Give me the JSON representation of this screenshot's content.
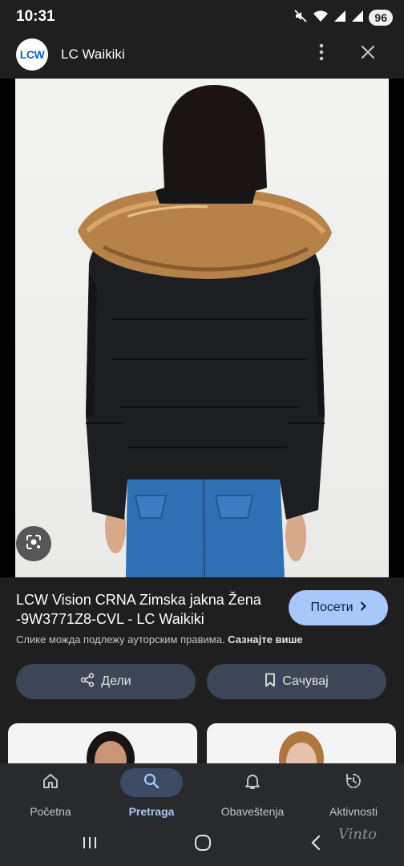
{
  "status_bar": {
    "time": "10:31",
    "battery": "96",
    "icons": [
      "mute-icon",
      "wifi-icon",
      "signal-icon",
      "signal-icon"
    ]
  },
  "header": {
    "logo_text": "LCW",
    "site_name": "LC Waikiki",
    "icons": [
      "more-vert-icon",
      "close-icon"
    ]
  },
  "image_viewer": {
    "lens_icon": "lens-icon"
  },
  "result": {
    "title": "LCW Vision CRNA Zimska jakna Žena -9W3771Z8-CVL - LC Waikiki",
    "visit_label": "Посети",
    "copyright_text": "Слике можда подлежу ауторским правима. ",
    "copyright_link": "Сазнајте више",
    "share_label": "Дели",
    "save_label": "Сачувај"
  },
  "bottom_nav": {
    "items": [
      {
        "label": "Početna",
        "icon": "home-icon",
        "active": false
      },
      {
        "label": "Pretraga",
        "icon": "search-icon",
        "active": true
      },
      {
        "label": "Obaveštenja",
        "icon": "bell-icon",
        "active": false
      },
      {
        "label": "Aktivnosti",
        "icon": "history-icon",
        "active": false
      }
    ]
  },
  "system_nav": {
    "icons": [
      "recents-icon",
      "home-circle-icon",
      "back-icon"
    ]
  },
  "watermark": "Vinto",
  "colors": {
    "background": "#1f1f1f",
    "accent": "#a8c7fa",
    "button_bg": "#3c4656",
    "nav_bg": "#282a2d"
  }
}
